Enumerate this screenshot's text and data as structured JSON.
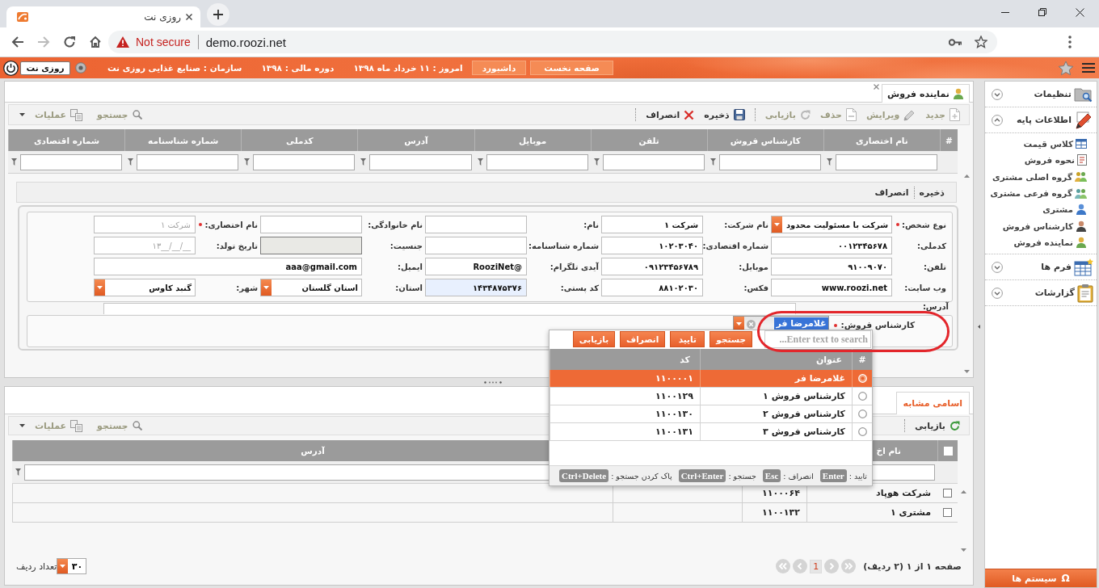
{
  "browser": {
    "tab_title": "روزی نت",
    "security_label": "Not secure",
    "url": "demo.roozi.net"
  },
  "header": {
    "nav_buttons": [
      "صفحه نخست",
      "داشبورد"
    ],
    "info": [
      "امروز : ۱۱ خرداد ماه ۱۳۹۸",
      "دوره مالی : ۱۳۹۸",
      "سازمان : صنایع غذایی روزی نت"
    ],
    "user_button": "روزی نت"
  },
  "sidebar": {
    "sections": [
      {
        "kind": "settings",
        "label": "تنظیمات",
        "expanded": false
      },
      {
        "kind": "basic",
        "label": "اطلاعات پایه",
        "expanded": true,
        "items": [
          {
            "kind": "grid",
            "label": "کلاس قیمت"
          },
          {
            "kind": "list",
            "label": "نحوه فروش"
          },
          {
            "kind": "group",
            "label": "گروه اصلی مشتری"
          },
          {
            "kind": "subgroup",
            "label": "گروه فرعی مشتری"
          },
          {
            "kind": "customer",
            "label": "مشتری"
          },
          {
            "kind": "expert",
            "label": "کارشناس فروش"
          },
          {
            "kind": "agent",
            "label": "نماینده فروش"
          }
        ]
      },
      {
        "kind": "forms",
        "label": "فرم ها",
        "expanded": false
      },
      {
        "kind": "reports",
        "label": "گزارشات",
        "expanded": false
      }
    ],
    "systems_button": {
      "icon": "Ω",
      "label": "سیستم ها"
    }
  },
  "page_tab": {
    "label": "نماینده فروش",
    "selected": true
  },
  "main_toolbar": {
    "groups": [
      [
        {
          "kind": "new",
          "label": "جدید",
          "disabled": true
        },
        {
          "kind": "edit",
          "label": "ویرایش",
          "disabled": true
        },
        {
          "kind": "delete",
          "label": "حذف",
          "disabled": true
        },
        {
          "kind": "restore",
          "label": "بازیابی",
          "disabled": true
        }
      ],
      [
        {
          "kind": "save",
          "label": "ذخیره",
          "disabled": false
        },
        {
          "kind": "cancel",
          "label": "انصراف",
          "disabled": false
        }
      ]
    ],
    "tools": [
      {
        "kind": "search",
        "label": "جستجو",
        "disabled": true
      },
      {
        "kind": "operations",
        "label": "عملیات",
        "disabled": true
      }
    ]
  },
  "grid": {
    "row_number_header": "#",
    "columns": [
      "نام اختصاری",
      "کارشناس فروش",
      "تلفن",
      "موبایل",
      "آدرس",
      "کدملی",
      "شماره شناسنامه",
      "شماره اقتصادی"
    ]
  },
  "form": {
    "actions": [
      "ذخیره",
      "انصراف"
    ],
    "rows": [
      [
        {
          "label": "نوع شخص:",
          "required": true,
          "kind": "select",
          "value": "شرکت با مسئولیت محدود",
          "disabled": false,
          "highlighted": false
        },
        {
          "label": "نام شرکت:",
          "required": false,
          "kind": "text",
          "value": "شرکت ۱",
          "disabled": false,
          "highlighted": false
        },
        {
          "label": "نام:",
          "required": false,
          "kind": "text",
          "disabled": false,
          "highlighted": false
        },
        {
          "label": "نام خانوادگی:",
          "required": false,
          "kind": "text",
          "disabled": false,
          "highlighted": false
        },
        {
          "label": "نام اختصاری:",
          "required": true,
          "kind": "text",
          "placeholder": "شرکت ۱",
          "disabled": false,
          "highlighted": false
        }
      ],
      [
        {
          "label": "کدملی:",
          "required": false,
          "kind": "text",
          "value": "۰۰۱۲۳۴۵۶۷۸",
          "disabled": false,
          "highlighted": false
        },
        {
          "label": "شماره اقتصادی:",
          "required": false,
          "kind": "text",
          "value": "۱۰۲۰۳۰۴۰",
          "disabled": false,
          "highlighted": false
        },
        {
          "label": "شماره شناسنامه:",
          "required": false,
          "kind": "text",
          "disabled": false,
          "highlighted": false
        },
        {
          "label": "جنسیت:",
          "required": false,
          "kind": "text",
          "disabled": true,
          "highlighted": false
        },
        {
          "label": "تاریخ تولد:",
          "required": false,
          "kind": "text",
          "placeholder": "۱۳__/__/__",
          "disabled": false,
          "highlighted": false
        }
      ],
      [
        {
          "label": "تلفن:",
          "required": false,
          "kind": "text",
          "value": "۹۱۰۰۹۰۷۰",
          "disabled": false,
          "highlighted": false
        },
        {
          "label": "موبایل:",
          "required": false,
          "kind": "text",
          "value": "۰۹۱۲۳۴۵۶۷۸۹",
          "disabled": false,
          "highlighted": false
        },
        {
          "label": "آیدی تلگرام:",
          "required": false,
          "kind": "text",
          "value": "RooziNet@",
          "disabled": false,
          "highlighted": false
        },
        {
          "label": "ایمیل:",
          "required": false,
          "kind": "wide",
          "value": "aaa@gmail.com",
          "disabled": false,
          "highlighted": false
        }
      ],
      [
        {
          "label": "وب سایت:",
          "required": false,
          "kind": "text",
          "value": "www.roozi.net",
          "disabled": false,
          "highlighted": false
        },
        {
          "label": "فکس:",
          "required": false,
          "kind": "text",
          "value": "۸۸۱۰۲۰۳۰",
          "disabled": false,
          "highlighted": false
        },
        {
          "label": "کد پستی:",
          "required": false,
          "kind": "text",
          "value": "۱۴۳۴۸۷۵۳۷۶",
          "disabled": false,
          "highlighted": true
        },
        {
          "label": "استان:",
          "required": false,
          "kind": "select",
          "value": "استان گلستان",
          "disabled": false,
          "highlighted": false
        },
        {
          "label": "شهر:",
          "required": false,
          "kind": "select",
          "value": "گنبد کاوس",
          "disabled": false,
          "highlighted": false
        }
      ]
    ],
    "address": {
      "label": "آدرس:"
    },
    "sales_expert": {
      "label": "کارشناس فروش:",
      "required": true,
      "value": "غلامرضا فر",
      "value_selected": true
    }
  },
  "lookup_popup": {
    "search_placeholder": "Enter text to search...",
    "buttons": [
      "جستجو",
      "تایید",
      "انصراف",
      "بازیابی"
    ],
    "columns": [
      "#",
      "عنوان",
      "کد"
    ],
    "rows": [
      {
        "title": "غلامرضا فر",
        "code": "۱۱۰۰۰۰۱",
        "selected": true
      },
      {
        "title": "کارشناس فروش ۱",
        "code": "۱۱۰۰۱۲۹",
        "selected": false
      },
      {
        "title": "کارشناس فروش ۲",
        "code": "۱۱۰۰۱۳۰",
        "selected": false
      },
      {
        "title": "کارشناس فروش ۳",
        "code": "۱۱۰۰۱۳۱",
        "selected": false
      }
    ],
    "shortcuts": [
      {
        "label": "تایید :",
        "key": "Enter"
      },
      {
        "label": "انصراف :",
        "key": "Esc"
      },
      {
        "label": "جستجو :",
        "key": "Ctrl+Enter"
      },
      {
        "label": "پاک کردن جستجو :",
        "key": "Ctrl+Delete"
      }
    ]
  },
  "similar": {
    "tab": {
      "label": "اسامی مشابه",
      "selected": true
    },
    "toolbar": [
      {
        "kind": "restore",
        "label": "بازیابی",
        "disabled": false
      }
    ],
    "tools": [
      {
        "kind": "search",
        "label": "جستجو",
        "disabled": true
      },
      {
        "kind": "operations",
        "label": "عملیات",
        "disabled": true
      }
    ],
    "select_all_checked": false,
    "name_header": "نام اخ",
    "address_header": "آدرس",
    "rows": [
      {
        "checked": false,
        "name": "شرکت هوپاد",
        "column_2": "۱۱۰۰۰۶۴"
      },
      {
        "checked": false,
        "name": "مشتری ۱",
        "column_2": "۱۱۰۰۱۳۲"
      }
    ],
    "pager": {
      "info": "صفحه ۱ از ۱ (۲ ردیف)",
      "page": "1",
      "rows_label": "تعداد ردیف",
      "rows_value": "۳۰"
    }
  }
}
